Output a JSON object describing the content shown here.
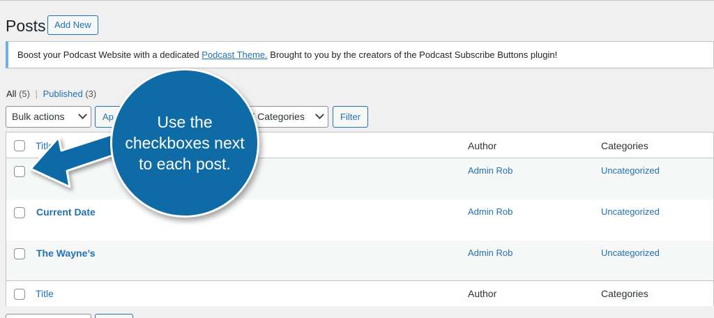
{
  "header": {
    "title": "Posts",
    "add_new": "Add New"
  },
  "notice": {
    "text_before": "Boost your Podcast Website with a dedicated ",
    "link": "Podcast Theme.",
    "text_after": " Brought to you by the creators of the Podcast Subscribe Buttons plugin!"
  },
  "filters": {
    "all_label": "All",
    "all_count": "(5)",
    "separator": "|",
    "published_label": "Published",
    "published_count": "(3)"
  },
  "toolbar": {
    "bulk_actions": "Bulk actions",
    "apply_partial": "Ap",
    "categories_partial": "ll Categories",
    "filter": "Filter"
  },
  "table": {
    "columns": {
      "title": "Title",
      "author": "Author",
      "categories": "Categories"
    },
    "rows": [
      {
        "title": "",
        "author": "Admin Rob",
        "category": "Uncategorized"
      },
      {
        "title": "Current Date",
        "author": "Admin Rob",
        "category": "Uncategorized"
      },
      {
        "title": "The Wayne’s",
        "author": "Admin Rob",
        "category": "Uncategorized"
      }
    ]
  },
  "callout": {
    "text": "Use the checkboxes next to each post."
  },
  "colors": {
    "accent": "#2271b1",
    "callout": "#0f6ba6",
    "notice_border": "#72aee6"
  }
}
